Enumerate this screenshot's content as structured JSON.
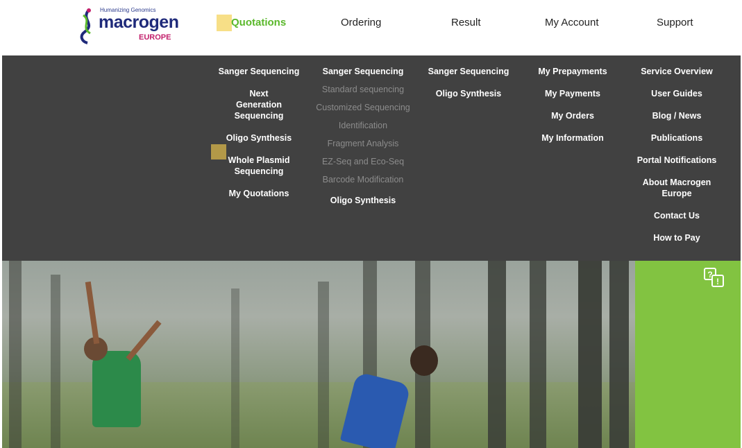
{
  "logo": {
    "tagline": "Humanizing Genomics",
    "brand": "macrogen",
    "region": "EUROPE",
    "brand_color": "#1f2a7a",
    "region_color": "#c21f6b"
  },
  "nav": {
    "items": [
      "Quotations",
      "Ordering",
      "Result",
      "My Account",
      "Support"
    ],
    "active": "Quotations",
    "active_color": "#5ab82b"
  },
  "menu": {
    "quotations": [
      "Sanger Sequencing",
      "Next Generation Sequencing",
      "Oligo Synthesis",
      "Whole Plasmid Sequencing",
      "My Quotations"
    ],
    "ordering": {
      "head": "Sanger Sequencing",
      "subs": [
        "Standard sequencing",
        "Customized Sequencing",
        "Identification",
        "Fragment Analysis",
        "EZ-Seq and Eco-Seq",
        "Barcode Modification"
      ],
      "tail": "Oligo Synthesis"
    },
    "result": [
      "Sanger Sequencing",
      "Oligo Synthesis"
    ],
    "my_account": [
      "My Prepayments",
      "My Payments",
      "My Orders",
      "My Information"
    ],
    "support": [
      "Service Overview",
      "User Guides",
      "Blog / News",
      "Publications",
      "Portal Notifications",
      "About Macrogen Europe",
      "Contact Us",
      "How to Pay"
    ]
  },
  "side_panel": {
    "icon": "chat-help-icon",
    "color": "#82c341"
  },
  "colors": {
    "menu_bg": "#414141",
    "highlight": "#f6dc7a"
  }
}
